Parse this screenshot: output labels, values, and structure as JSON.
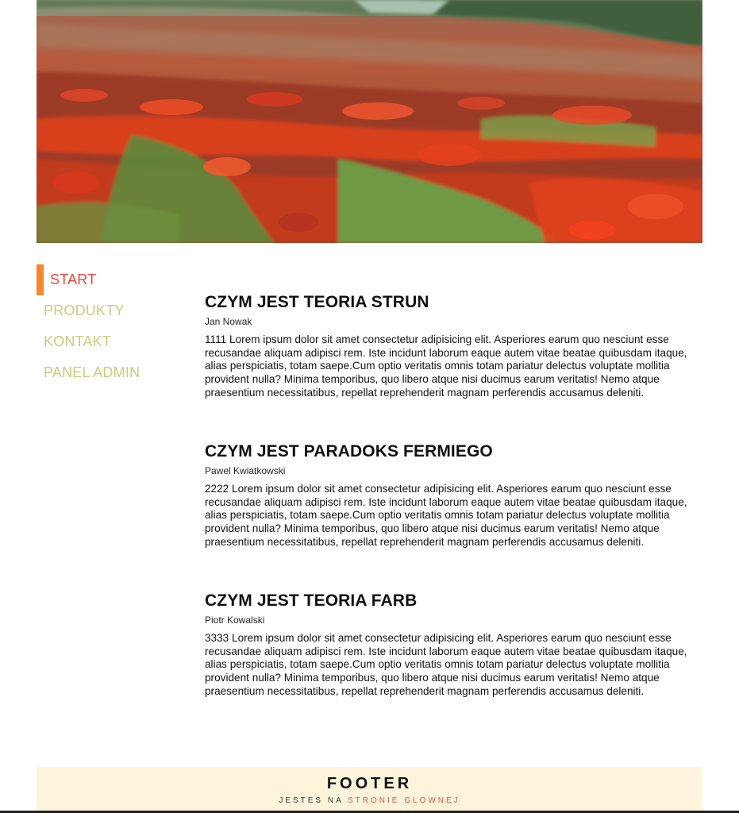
{
  "nav": {
    "items": [
      {
        "label": "START",
        "active": true
      },
      {
        "label": "PRODUKTY",
        "active": false
      },
      {
        "label": "KONTAKT",
        "active": false
      },
      {
        "label": "PANEL ADMIN",
        "active": false
      }
    ]
  },
  "articles": [
    {
      "title": "CZYM JEST TEORIA STRUN",
      "author": "Jan Nowak",
      "body": "1111 Lorem ipsum dolor sit amet consectetur adipisicing elit. Asperiores earum quo nesciunt esse recusandae aliquam adipisci rem. Iste incidunt laborum eaque autem vitae beatae quibusdam itaque, alias perspiciatis, totam saepe.Cum optio veritatis omnis totam pariatur delectus voluptate mollitia provident nulla? Minima temporibus, quo libero atque nisi ducimus earum veritatis! Nemo atque praesentium necessitatibus, repellat reprehenderit magnam perferendis accusamus deleniti."
    },
    {
      "title": "CZYM JEST PARADOKS FERMIEGO",
      "author": "Pawel Kwiatkowski",
      "body": "2222 Lorem ipsum dolor sit amet consectetur adipisicing elit. Asperiores earum quo nesciunt esse recusandae aliquam adipisci rem. Iste incidunt laborum eaque autem vitae beatae quibusdam itaque, alias perspiciatis, totam saepe.Cum optio veritatis omnis totam pariatur delectus voluptate mollitia provident nulla? Minima temporibus, quo libero atque nisi ducimus earum veritatis! Nemo atque praesentium necessitatibus, repellat reprehenderit magnam perferendis accusamus deleniti."
    },
    {
      "title": "CZYM JEST TEORIA FARB",
      "author": "Piotr Kowalski",
      "body": "3333 Lorem ipsum dolor sit amet consectetur adipisicing elit. Asperiores earum quo nesciunt esse recusandae aliquam adipisci rem. Iste incidunt laborum eaque autem vitae beatae quibusdam itaque, alias perspiciatis, totam saepe.Cum optio veritatis omnis totam pariatur delectus voluptate mollitia provident nulla? Minima temporibus, quo libero atque nisi ducimus earum veritatis! Nemo atque praesentium necessitatibus, repellat reprehenderit magnam perferendis accusamus deleniti."
    }
  ],
  "footer": {
    "title": "FOOTER",
    "sub_prefix": "JESTES NA",
    "sub_highlight": "STRONIE GLOWNEJ"
  },
  "colors": {
    "nav_active": "#f0473a",
    "nav_inactive": "#c9cc7a",
    "nav_indicator": "#f7862c",
    "footer_bg": "#fdf4db",
    "footer_highlight": "#e0523a"
  },
  "icons": {
    "hero": "poppy-field-painting"
  }
}
